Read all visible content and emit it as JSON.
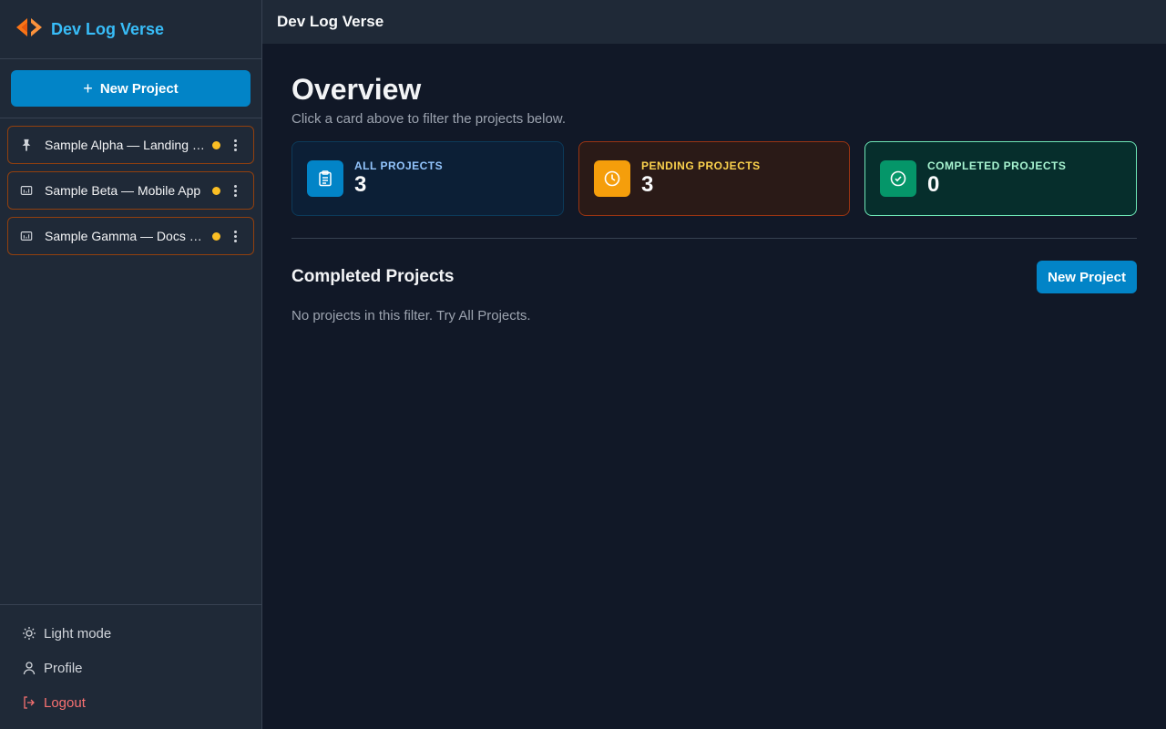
{
  "app": {
    "name": "Dev Log Verse"
  },
  "sidebar": {
    "new_project_label": "New Project",
    "projects": [
      {
        "name": "Sample Alpha — Landing Page",
        "icon": "pin-icon",
        "status_color": "#fbbf24"
      },
      {
        "name": "Sample Beta — Mobile App",
        "icon": "folder-icon",
        "status_color": "#fbbf24"
      },
      {
        "name": "Sample Gamma — Docs Site",
        "icon": "folder-icon",
        "status_color": "#fbbf24"
      }
    ],
    "footer": {
      "light_mode": "Light mode",
      "profile": "Profile",
      "logout": "Logout"
    }
  },
  "topbar": {
    "title": "Dev Log Verse"
  },
  "overview": {
    "title": "Overview",
    "subtitle": "Click a card above to filter the projects below.",
    "cards": [
      {
        "label": "ALL PROJECTS",
        "count": "3",
        "icon": "clipboard-icon",
        "color": "#0284c7"
      },
      {
        "label": "PENDING PROJECTS",
        "count": "3",
        "icon": "clock-icon",
        "color": "#f59e0b"
      },
      {
        "label": "COMPLETED PROJECTS",
        "count": "0",
        "icon": "check-circle-icon",
        "color": "#059669"
      }
    ]
  },
  "section": {
    "title": "Completed Projects",
    "button_label": "New Project",
    "empty_text": "No projects in this filter. Try All Projects."
  }
}
